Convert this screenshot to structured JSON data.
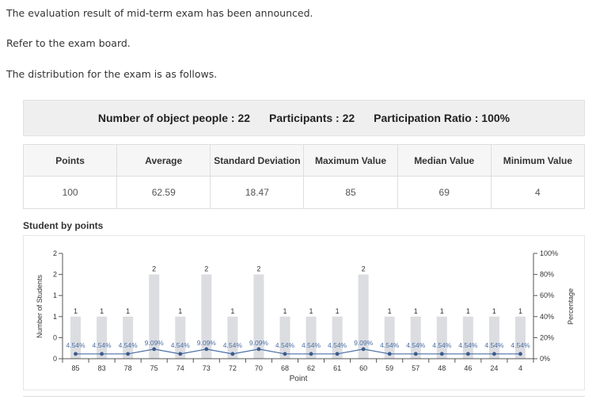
{
  "messages": [
    "The evaluation result of mid-term exam has been announced.",
    "Refer to the exam board.",
    "The distribution for the exam is as follows."
  ],
  "summary": {
    "object_people": "Number of object people : 22",
    "participants": "Participants : 22",
    "participation_ratio": "Participation Ratio : 100%"
  },
  "stats_table": {
    "headers": [
      "Points",
      "Average",
      "Standard Deviation",
      "Maximum Value",
      "Median Value",
      "Minimum Value"
    ],
    "values": [
      "100",
      "62.59",
      "18.47",
      "85",
      "69",
      "4"
    ]
  },
  "chart_section_title": "Student by points",
  "chart_data": {
    "type": "bar",
    "xlabel": "Point",
    "ylabel": "Number of Students",
    "y2label": "Percentage",
    "categories": [
      "85",
      "83",
      "78",
      "75",
      "74",
      "73",
      "72",
      "70",
      "68",
      "62",
      "61",
      "60",
      "59",
      "57",
      "48",
      "46",
      "24",
      "4"
    ],
    "series": [
      {
        "values": [
          1,
          1,
          1,
          2,
          1,
          2,
          1,
          2,
          1,
          1,
          1,
          2,
          1,
          1,
          1,
          1,
          1,
          1
        ]
      },
      {
        "values": [
          4.54,
          4.54,
          4.54,
          9.09,
          4.54,
          9.09,
          4.54,
          9.09,
          4.54,
          4.54,
          4.54,
          9.09,
          4.54,
          4.54,
          4.54,
          4.54,
          4.54,
          4.54
        ]
      }
    ],
    "bar_labels": [
      "1",
      "1",
      "1",
      "2",
      "1",
      "2",
      "1",
      "2",
      "1",
      "1",
      "1",
      "2",
      "1",
      "1",
      "1",
      "1",
      "1",
      "1"
    ],
    "line_labels": [
      "4.54%",
      "4.54%",
      "4.54%",
      "9.09%",
      "4.54%",
      "9.09%",
      "4.54%",
      "9.09%",
      "4.54%",
      "4.54%",
      "4.54%",
      "9.09%",
      "4.54%",
      "4.54%",
      "4.54%",
      "4.54%",
      "4.54%",
      "4.54%"
    ],
    "y_ticks": [
      "0",
      "0",
      "1",
      "1",
      "2",
      "2"
    ],
    "y_tick_values": [
      0,
      0.5,
      1,
      1.5,
      2,
      2.5
    ],
    "ylim": [
      0,
      2.5
    ],
    "y2_ticks": [
      "0%",
      "20%",
      "40%",
      "60%",
      "80%",
      "100%"
    ],
    "y2_tick_values": [
      0,
      20,
      40,
      60,
      80,
      100
    ],
    "y2lim": [
      0,
      100
    ],
    "colors": {
      "bar": "#dcdde1",
      "line": "#4a6fa5",
      "point": "#3b5b8c"
    }
  }
}
